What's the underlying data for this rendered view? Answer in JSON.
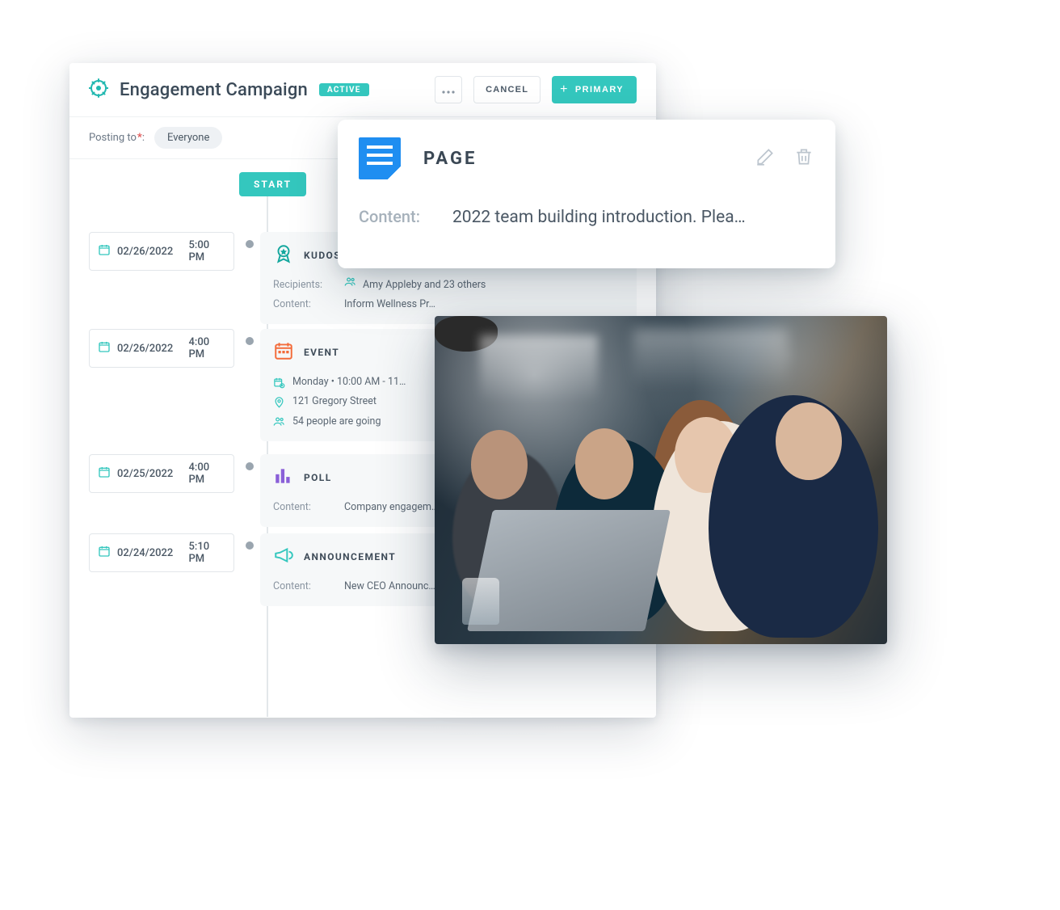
{
  "header": {
    "title": "Engagement Campaign",
    "status_badge": "ACTIVE",
    "cancel_label": "CANCEL",
    "primary_label": "PRIMARY"
  },
  "posting": {
    "label": "Posting to",
    "audience": "Everyone"
  },
  "timeline": {
    "start_label": "START",
    "items": [
      {
        "date": "02/26/2022",
        "time": "5:00 PM",
        "type": "KUDOS",
        "recipients_label": "Recipients:",
        "recipients_value": "Amy Appleby and 23 others",
        "content_label": "Content:",
        "content_value": "Inform Wellness Pr…"
      },
      {
        "date": "02/26/2022",
        "time": "4:00 PM",
        "type": "EVENT",
        "when": "Monday  •  10:00 AM - 11…",
        "where": "121 Gregory Street",
        "attending": "54 people are going"
      },
      {
        "date": "02/25/2022",
        "time": "4:00 PM",
        "type": "POLL",
        "content_label": "Content:",
        "content_value": "Company engagem…"
      },
      {
        "date": "02/24/2022",
        "time": "5:10 PM",
        "type": "ANNOUNCEMENT",
        "content_label": "Content:",
        "content_value": "New CEO Announc…"
      }
    ]
  },
  "page_card": {
    "title": "PAGE",
    "content_label": "Content:",
    "content_value": "2022 team building introduction. Plea…"
  }
}
